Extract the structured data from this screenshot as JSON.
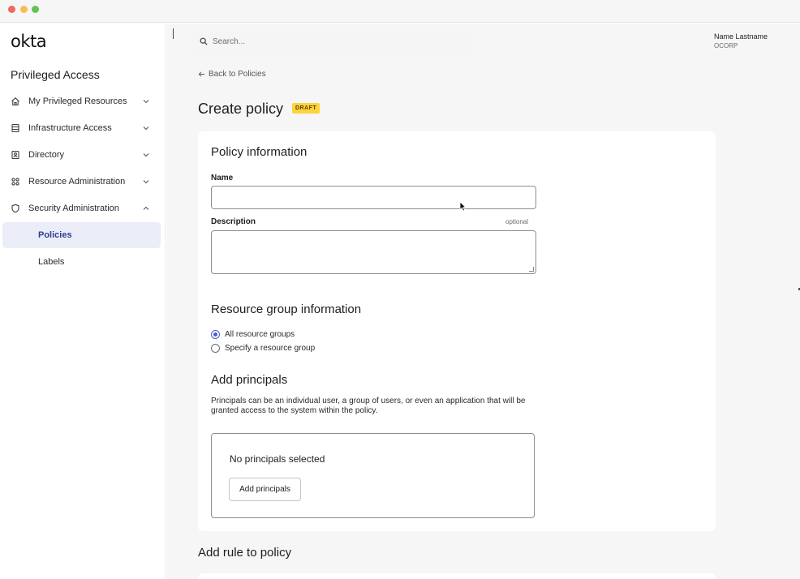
{
  "window": {
    "traffic_lights": [
      "close",
      "minimize",
      "maximize"
    ]
  },
  "sidebar": {
    "logo": "okta",
    "section_title": "Privileged Access",
    "items": [
      {
        "label": "My Privileged Resources",
        "icon": "home-icon",
        "expanded": false
      },
      {
        "label": "Infrastructure Access",
        "icon": "server-icon",
        "expanded": false
      },
      {
        "label": "Directory",
        "icon": "directory-icon",
        "expanded": false
      },
      {
        "label": "Resource Administration",
        "icon": "grid-icon",
        "expanded": false
      },
      {
        "label": "Security Administration",
        "icon": "shield-icon",
        "expanded": true
      }
    ],
    "sub_items": [
      {
        "label": "Policies",
        "active": true
      },
      {
        "label": "Labels",
        "active": false
      }
    ]
  },
  "header": {
    "search_placeholder": "Search...",
    "user_name": "Name Lastname",
    "user_org": "OCORP"
  },
  "page": {
    "back_link": "Back to Policies",
    "title": "Create policy",
    "status_badge": "DRAFT"
  },
  "policy_info": {
    "heading": "Policy information",
    "name_label": "Name",
    "name_value": "",
    "description_label": "Description",
    "description_hint": "optional",
    "description_value": ""
  },
  "resource_group": {
    "heading": "Resource group information",
    "options": [
      {
        "label": "All resource groups",
        "selected": true
      },
      {
        "label": "Specify a resource group",
        "selected": false
      }
    ]
  },
  "principals": {
    "heading": "Add principals",
    "description": "Principals can be an individual user, a group of users, or even an application that will be granted access to the system within the policy.",
    "empty_state": "No principals selected",
    "add_button": "Add principals"
  },
  "rules": {
    "heading": "Add rule to policy"
  },
  "colors": {
    "accent": "#4a5ad1",
    "active_nav_bg": "#ebeef8",
    "active_nav_text": "#2e3e8c",
    "draft_badge": "#ffd43b",
    "page_bg": "#f6f6f7"
  }
}
